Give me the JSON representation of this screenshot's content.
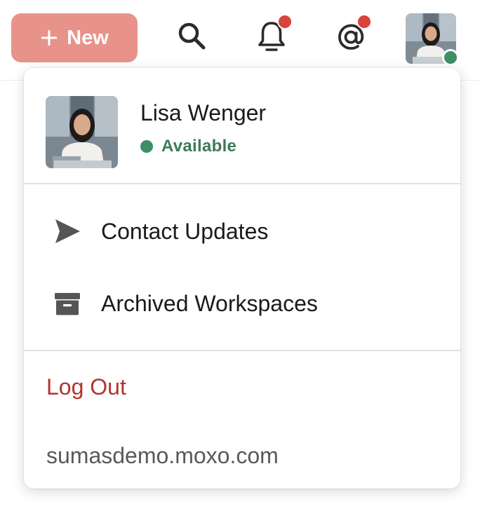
{
  "topbar": {
    "new_button_label": "New",
    "search_icon": "search-icon",
    "bell_icon": "bell-icon",
    "mention_icon": "at-sign-icon",
    "notification_dot_color": "#d9433a",
    "accent_color": "#e8938a"
  },
  "profile": {
    "name": "Lisa Wenger",
    "status": "Available",
    "status_color": "#3f8f64"
  },
  "menu": {
    "items": [
      {
        "label": "Contact Updates",
        "icon": "send-icon"
      },
      {
        "label": "Archived Workspaces",
        "icon": "archive-box-icon"
      }
    ],
    "logout_label": "Log Out",
    "logout_color": "#b4332d",
    "domain": "sumasdemo.moxo.com"
  }
}
